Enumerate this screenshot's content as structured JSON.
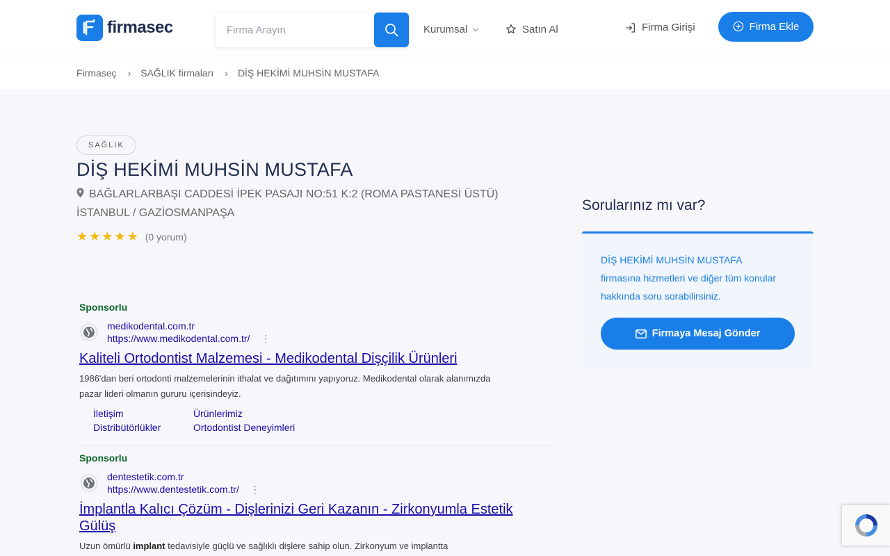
{
  "header": {
    "logo_text": "firmasec",
    "search_placeholder": "Firma Arayın",
    "nav": {
      "corporate": "Kurumsal",
      "buy": "Satın Al"
    },
    "login": "Firma Girişi",
    "add_company": "Firma Ekle"
  },
  "breadcrumb": {
    "items": [
      "Firmaseç",
      "SAĞLIK firmaları",
      "DİŞ HEKİMİ MUHSİN MUSTAFA"
    ]
  },
  "company": {
    "category": "SAĞLIK",
    "name": "DİŞ HEKİMİ MUHSİN MUSTAFA",
    "address": "BAĞLARLARBAŞI CADDESİ İPEK PASAJI NO:51 K:2 (ROMA PASTANESİ ÜSTÜ) İSTANBUL / GAZİOSMANPAŞA",
    "rating": 5,
    "review_count": "(0 yorum)"
  },
  "ads": [
    {
      "sponsored": "Sponsorlu",
      "domain": "medikodental.com.tr",
      "url": "https://www.medikodental.com.tr/",
      "title": "Kaliteli Ortodontist Malzemesi - Medikodental Dişçilik Ürünleri",
      "desc": "1986'dan beri ortodonti malzemelerinin ithalat ve dağıtımını yapıyoruz. Medikodental olarak alanımızda pazar lideri olmanın gururu içerisindeyiz.",
      "sitelinks": [
        "İletişim",
        "Ürünlerimiz",
        "Distribütörlükler",
        "Ortodontist Deneyimleri"
      ]
    },
    {
      "sponsored": "Sponsorlu",
      "domain": "dentestetik.com.tr",
      "url": "https://www.dentestetik.com.tr/",
      "title": "İmplantla Kalıcı Çözüm - Dişlerinizi Geri Kazanın - Zirkonyumla Estetik Gülüş",
      "desc_before": "Uzun ömürlü ",
      "desc_bold": "implant",
      "desc_after": " tedavisiyle güçlü ve sağlıklı dişlere sahip olun. Zirkonyum ve implantta"
    }
  ],
  "sidebar": {
    "title": "Sorularınız mı var?",
    "text": "DİŞ HEKİMİ MUHSİN MUSTAFA firmasına hizmetleri ve diğer tüm konular hakkında soru sorabilirsiniz.",
    "button": "Firmaya Mesaj Gönder"
  },
  "colors": {
    "primary": "#1a7ee8",
    "ad_link": "#1a0dab",
    "sponsored": "#0d652d",
    "star": "#f5b800"
  }
}
